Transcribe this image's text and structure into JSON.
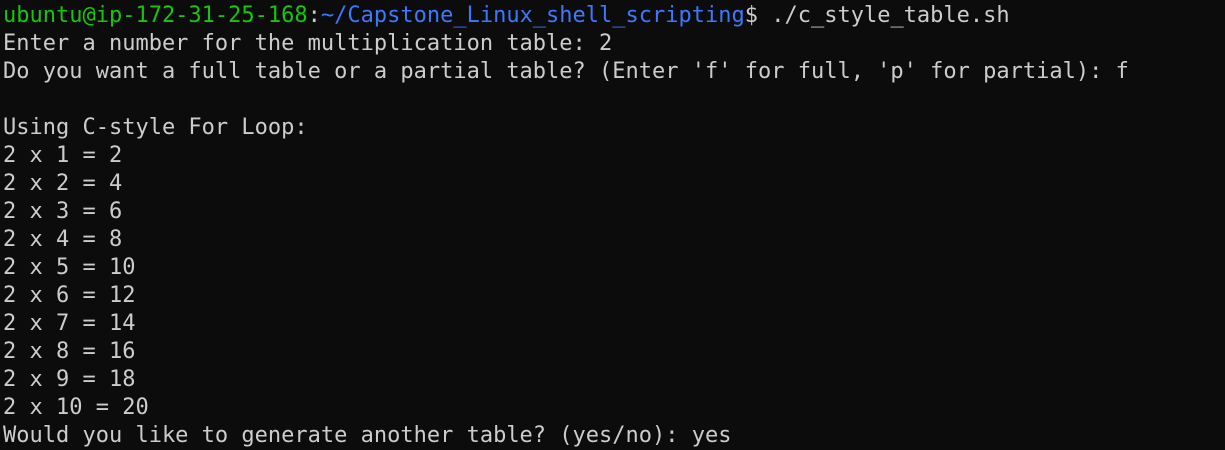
{
  "terminal": {
    "prompt": {
      "user_host": "ubuntu@ip-172-31-25-168",
      "colon": ":",
      "path": "~/Capstone_Linux_shell_scripting",
      "symbol": "$ ",
      "command": "./c_style_table.sh"
    },
    "input_number_prompt": "Enter a number for the multiplication table: ",
    "input_number_value": "2",
    "table_type_prompt": "Do you want a full table or a partial table? (Enter 'f' for full, 'p' for partial): ",
    "table_type_value": "f",
    "blank": "",
    "loop_heading": "Using C-style For Loop:",
    "table_rows": [
      "2 x 1 = 2",
      "2 x 2 = 4",
      "2 x 3 = 6",
      "2 x 4 = 8",
      "2 x 5 = 10",
      "2 x 6 = 12",
      "2 x 7 = 14",
      "2 x 8 = 16",
      "2 x 9 = 18",
      "2 x 10 = 20"
    ],
    "again_prompt": "Would you like to generate another table? (yes/no): ",
    "again_value": "yes"
  },
  "colors": {
    "background": "#0c0c0c",
    "text": "#cccccc",
    "user_host": "#16c60c",
    "path": "#3b78ff"
  }
}
